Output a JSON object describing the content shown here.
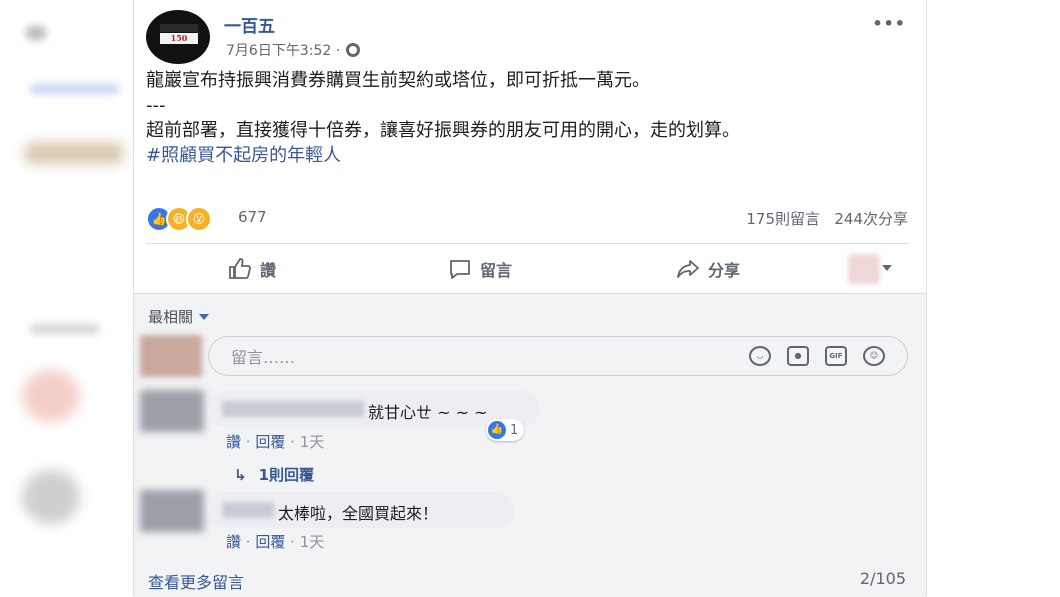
{
  "post": {
    "page_name": "一百五",
    "logo_text": "150",
    "meta_time": "7月6日下午3:52 ·",
    "more_icon": "more-horizontal-icon",
    "body_line1": "龍巖宣布持振興消費券購買生前契約或塔位，即可折抵一萬元。",
    "body_sep": "---",
    "body_line2": "超前部署，直接獲得十倍券，讓喜好振興券的朋友可用的開心，走的划算。",
    "hashtag": "#照顧買不起房的年輕人"
  },
  "reactions": {
    "count": "677",
    "comments": "175則留言",
    "shares": "244次分享"
  },
  "actions": {
    "like": "讚",
    "comment": "留言",
    "share": "分享"
  },
  "comments": {
    "sort_label": "最相關",
    "input_placeholder": "留言……",
    "items": [
      {
        "text": "就甘心ㄝ ~ ~ ~",
        "like": "讚",
        "reply": "回覆",
        "time": "1天",
        "reaction_count": "1",
        "replies_label": "1則回覆"
      },
      {
        "text": "太棒啦，全國買起來！",
        "like": "讚",
        "reply": "回覆",
        "time": "1天"
      }
    ],
    "view_more": "查看更多留言",
    "pager": "2/105"
  },
  "colors": {
    "link": "#385898",
    "like_blue": "#3578e5",
    "haha_yellow": "#f7b125"
  }
}
